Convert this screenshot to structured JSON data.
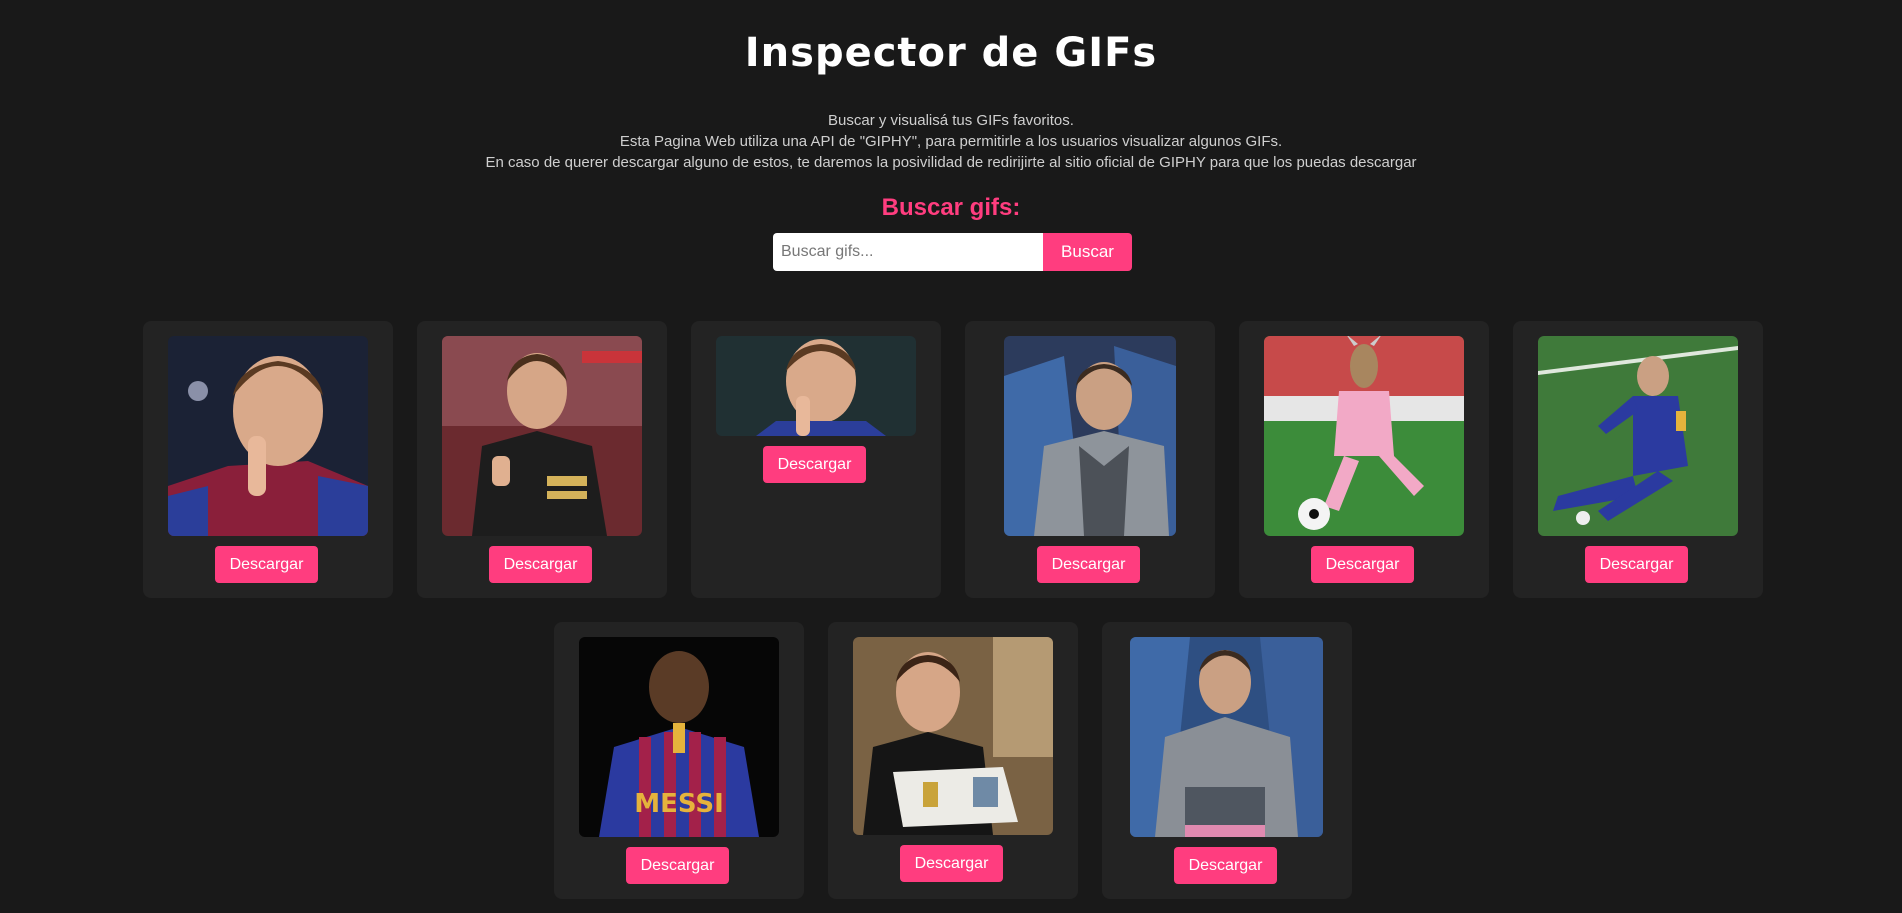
{
  "header": {
    "title": "Inspector de GIFs",
    "description": [
      "Buscar y visualisá tus GIFs favoritos.",
      "Esta Pagina Web utiliza una API de \"GIPHY\", para permitirle a los usuarios visualizar algunos GIFs.",
      "En caso de querer descargar alguno de estos, te daremos la posivilidad de redirijirte al sitio oficial de GIPHY para que los puedas descargar"
    ]
  },
  "search": {
    "label": "Buscar gifs:",
    "placeholder": "Buscar gifs...",
    "value": "",
    "button_label": "Buscar"
  },
  "colors": {
    "accent": "#ff3d7f",
    "background": "#191919",
    "card": "#232323"
  },
  "gifs": [
    {
      "download_label": "Descargar"
    },
    {
      "download_label": "Descargar"
    },
    {
      "download_label": "Descargar"
    },
    {
      "download_label": "Descargar"
    },
    {
      "download_label": "Descargar"
    },
    {
      "download_label": "Descargar"
    },
    {
      "download_label": "Descargar"
    },
    {
      "download_label": "Descargar"
    },
    {
      "download_label": "Descargar"
    }
  ]
}
